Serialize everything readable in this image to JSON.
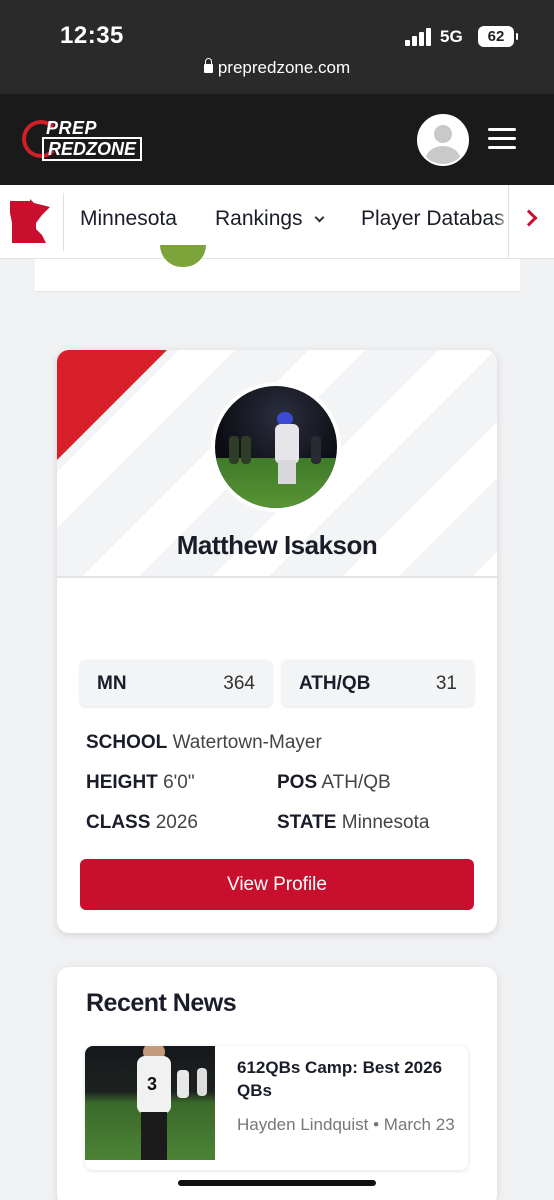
{
  "status": {
    "time": "12:35",
    "network": "5G",
    "battery": "62"
  },
  "browser": {
    "url": "prepredzone.com"
  },
  "header": {
    "logo_top": "PREP",
    "logo_bottom": "REDZONE"
  },
  "nav": {
    "items": [
      {
        "label": "Minnesota"
      },
      {
        "label": "Rankings"
      },
      {
        "label": "Player Databas"
      }
    ]
  },
  "player": {
    "name": "Matthew Isakson",
    "ranks": [
      {
        "label": "MN",
        "value": "364"
      },
      {
        "label": "ATH/QB",
        "value": "31"
      }
    ],
    "school_label": "SCHOOL",
    "school": "Watertown-Mayer",
    "height_label": "HEIGHT",
    "height": "6'0\"",
    "pos_label": "POS",
    "pos": "ATH/QB",
    "class_label": "CLASS",
    "class": "2026",
    "state_label": "STATE",
    "state": "Minnesota",
    "view_profile": "View Profile"
  },
  "news": {
    "title": "Recent News",
    "items": [
      {
        "headline": "612QBs Camp: Best 2026 QBs",
        "author": "Hayden Lindquist",
        "date": "March 23",
        "jersey": "3"
      }
    ]
  },
  "colors": {
    "brand_red": "#c8102e",
    "header_bg": "#1a1a1a"
  }
}
